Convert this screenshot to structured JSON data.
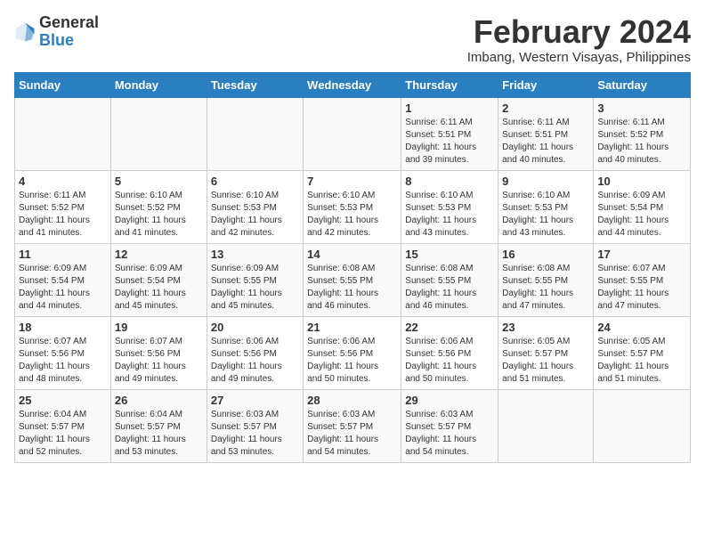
{
  "logo": {
    "general": "General",
    "blue": "Blue"
  },
  "title": "February 2024",
  "subtitle": "Imbang, Western Visayas, Philippines",
  "days_header": [
    "Sunday",
    "Monday",
    "Tuesday",
    "Wednesday",
    "Thursday",
    "Friday",
    "Saturday"
  ],
  "weeks": [
    [
      {
        "num": "",
        "info": ""
      },
      {
        "num": "",
        "info": ""
      },
      {
        "num": "",
        "info": ""
      },
      {
        "num": "",
        "info": ""
      },
      {
        "num": "1",
        "info": "Sunrise: 6:11 AM\nSunset: 5:51 PM\nDaylight: 11 hours\nand 39 minutes."
      },
      {
        "num": "2",
        "info": "Sunrise: 6:11 AM\nSunset: 5:51 PM\nDaylight: 11 hours\nand 40 minutes."
      },
      {
        "num": "3",
        "info": "Sunrise: 6:11 AM\nSunset: 5:52 PM\nDaylight: 11 hours\nand 40 minutes."
      }
    ],
    [
      {
        "num": "4",
        "info": "Sunrise: 6:11 AM\nSunset: 5:52 PM\nDaylight: 11 hours\nand 41 minutes."
      },
      {
        "num": "5",
        "info": "Sunrise: 6:10 AM\nSunset: 5:52 PM\nDaylight: 11 hours\nand 41 minutes."
      },
      {
        "num": "6",
        "info": "Sunrise: 6:10 AM\nSunset: 5:53 PM\nDaylight: 11 hours\nand 42 minutes."
      },
      {
        "num": "7",
        "info": "Sunrise: 6:10 AM\nSunset: 5:53 PM\nDaylight: 11 hours\nand 42 minutes."
      },
      {
        "num": "8",
        "info": "Sunrise: 6:10 AM\nSunset: 5:53 PM\nDaylight: 11 hours\nand 43 minutes."
      },
      {
        "num": "9",
        "info": "Sunrise: 6:10 AM\nSunset: 5:53 PM\nDaylight: 11 hours\nand 43 minutes."
      },
      {
        "num": "10",
        "info": "Sunrise: 6:09 AM\nSunset: 5:54 PM\nDaylight: 11 hours\nand 44 minutes."
      }
    ],
    [
      {
        "num": "11",
        "info": "Sunrise: 6:09 AM\nSunset: 5:54 PM\nDaylight: 11 hours\nand 44 minutes."
      },
      {
        "num": "12",
        "info": "Sunrise: 6:09 AM\nSunset: 5:54 PM\nDaylight: 11 hours\nand 45 minutes."
      },
      {
        "num": "13",
        "info": "Sunrise: 6:09 AM\nSunset: 5:55 PM\nDaylight: 11 hours\nand 45 minutes."
      },
      {
        "num": "14",
        "info": "Sunrise: 6:08 AM\nSunset: 5:55 PM\nDaylight: 11 hours\nand 46 minutes."
      },
      {
        "num": "15",
        "info": "Sunrise: 6:08 AM\nSunset: 5:55 PM\nDaylight: 11 hours\nand 46 minutes."
      },
      {
        "num": "16",
        "info": "Sunrise: 6:08 AM\nSunset: 5:55 PM\nDaylight: 11 hours\nand 47 minutes."
      },
      {
        "num": "17",
        "info": "Sunrise: 6:07 AM\nSunset: 5:55 PM\nDaylight: 11 hours\nand 47 minutes."
      }
    ],
    [
      {
        "num": "18",
        "info": "Sunrise: 6:07 AM\nSunset: 5:56 PM\nDaylight: 11 hours\nand 48 minutes."
      },
      {
        "num": "19",
        "info": "Sunrise: 6:07 AM\nSunset: 5:56 PM\nDaylight: 11 hours\nand 49 minutes."
      },
      {
        "num": "20",
        "info": "Sunrise: 6:06 AM\nSunset: 5:56 PM\nDaylight: 11 hours\nand 49 minutes."
      },
      {
        "num": "21",
        "info": "Sunrise: 6:06 AM\nSunset: 5:56 PM\nDaylight: 11 hours\nand 50 minutes."
      },
      {
        "num": "22",
        "info": "Sunrise: 6:06 AM\nSunset: 5:56 PM\nDaylight: 11 hours\nand 50 minutes."
      },
      {
        "num": "23",
        "info": "Sunrise: 6:05 AM\nSunset: 5:57 PM\nDaylight: 11 hours\nand 51 minutes."
      },
      {
        "num": "24",
        "info": "Sunrise: 6:05 AM\nSunset: 5:57 PM\nDaylight: 11 hours\nand 51 minutes."
      }
    ],
    [
      {
        "num": "25",
        "info": "Sunrise: 6:04 AM\nSunset: 5:57 PM\nDaylight: 11 hours\nand 52 minutes."
      },
      {
        "num": "26",
        "info": "Sunrise: 6:04 AM\nSunset: 5:57 PM\nDaylight: 11 hours\nand 53 minutes."
      },
      {
        "num": "27",
        "info": "Sunrise: 6:03 AM\nSunset: 5:57 PM\nDaylight: 11 hours\nand 53 minutes."
      },
      {
        "num": "28",
        "info": "Sunrise: 6:03 AM\nSunset: 5:57 PM\nDaylight: 11 hours\nand 54 minutes."
      },
      {
        "num": "29",
        "info": "Sunrise: 6:03 AM\nSunset: 5:57 PM\nDaylight: 11 hours\nand 54 minutes."
      },
      {
        "num": "",
        "info": ""
      },
      {
        "num": "",
        "info": ""
      }
    ]
  ]
}
